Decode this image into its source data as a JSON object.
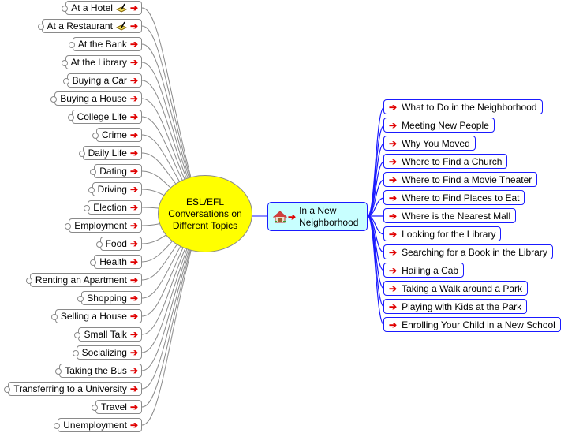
{
  "root": {
    "label_lines": [
      "ESL/EFL",
      "Conversations on",
      "Different Topics"
    ],
    "color": "#ffff00"
  },
  "left_topics": [
    {
      "label": "At a Hotel",
      "icon": "pencil-note-icon"
    },
    {
      "label": "At a Restaurant",
      "icon": "pencil-note-icon"
    },
    {
      "label": "At the Bank"
    },
    {
      "label": "At the Library"
    },
    {
      "label": "Buying a Car"
    },
    {
      "label": "Buying a House"
    },
    {
      "label": "College Life"
    },
    {
      "label": "Crime"
    },
    {
      "label": "Daily Life"
    },
    {
      "label": "Dating"
    },
    {
      "label": "Driving"
    },
    {
      "label": "Election"
    },
    {
      "label": "Employment"
    },
    {
      "label": "Food"
    },
    {
      "label": "Health"
    },
    {
      "label": "Renting an Apartment"
    },
    {
      "label": "Shopping"
    },
    {
      "label": "Selling a House"
    },
    {
      "label": "Small Talk"
    },
    {
      "label": "Socializing"
    },
    {
      "label": "Taking the Bus"
    },
    {
      "label": "Transferring to a University"
    },
    {
      "label": "Travel"
    },
    {
      "label": "Unemployment"
    }
  ],
  "subtopic": {
    "label_lines": [
      "In a New",
      "Neighborhood"
    ],
    "icon": "house-icon",
    "color": "#c8ffff"
  },
  "right_topics": [
    "What to Do in the Neighborhood",
    "Meeting New People",
    "Why You Moved",
    "Where to Find a Church",
    "Where to Find a Movie Theater",
    "Where to Find Places to Eat",
    "Where is the Nearest Mall",
    "Looking for the Library",
    "Searching for a Book in the Library",
    "Hailing a Cab",
    "Taking a Walk around a Park",
    "Playing with Kids at the Park",
    "Enrolling Your Child in a New School"
  ],
  "link_arrow": "➔",
  "colors": {
    "left_border": "#8a8a8a",
    "right_border": "#1a1aff",
    "arrow": "#e00000"
  }
}
